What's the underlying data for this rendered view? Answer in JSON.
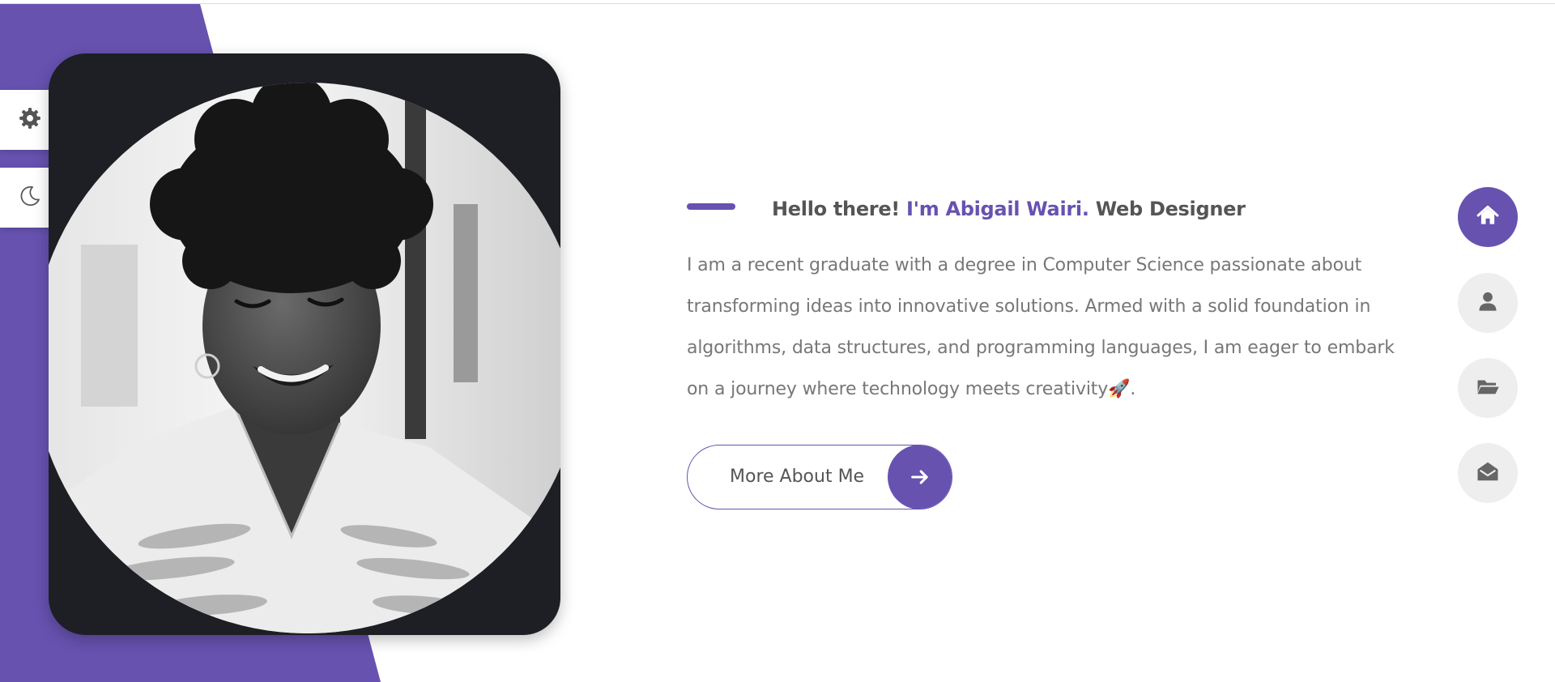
{
  "intro": {
    "greeting": "Hello there!",
    "name": "I'm Abigail Wairi.",
    "role": "Web Designer",
    "bio": "I am a recent graduate with a degree in Computer Science passionate about transforming ideas into innovative solutions. Armed with a solid foundation in algorithms, data structures, and programming languages, I am eager to embark on a journey where technology meets creativity🚀."
  },
  "cta": {
    "label": "More About Me",
    "icon": "arrow-right-icon"
  },
  "side_panel": {
    "settings_icon": "gear-icon",
    "theme_icon": "moon-icon"
  },
  "nav": [
    {
      "icon": "home-icon",
      "active": true
    },
    {
      "icon": "user-icon",
      "active": false
    },
    {
      "icon": "folder-open-icon",
      "active": false
    },
    {
      "icon": "envelope-open-icon",
      "active": false
    }
  ],
  "colors": {
    "accent": "#6752b0",
    "heading": "#555555",
    "body_text": "#777777",
    "card_bg": "#1d1f24",
    "nav_bg": "#eeeeee"
  }
}
